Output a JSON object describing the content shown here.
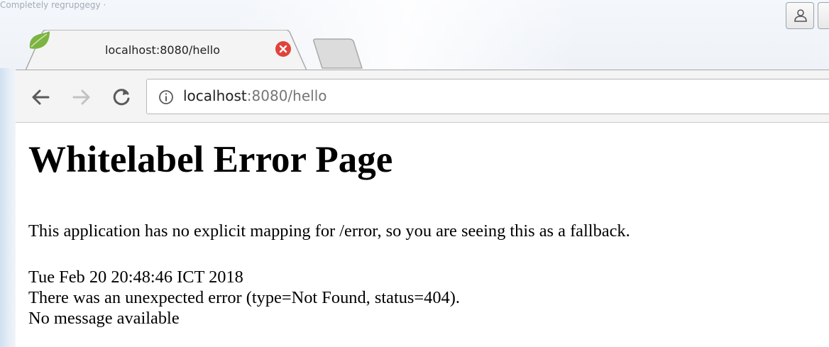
{
  "top_fragment": "Completely regrupgegy ·",
  "tab": {
    "title": "localhost:8080/hello",
    "favicon": "spring-leaf-icon",
    "close_icon": "close-icon"
  },
  "toolbar": {
    "back_icon": "back-arrow-icon",
    "forward_icon": "forward-arrow-icon",
    "reload_icon": "reload-icon",
    "info_icon": "info-icon",
    "url_host": "localhost",
    "url_rest": ":8080/hello"
  },
  "page": {
    "heading": "Whitelabel Error Page",
    "intro": "This application has no explicit mapping for /error, so you are seeing this as a fallback.",
    "timestamp": "Tue Feb 20 20:48:46 ICT 2018",
    "error_line": "There was an unexpected error (type=Not Found, status=404).",
    "message": "No message available"
  },
  "colors": {
    "close_red": "#e0433b",
    "leaf_green": "#7cb342",
    "text": "#000000"
  }
}
